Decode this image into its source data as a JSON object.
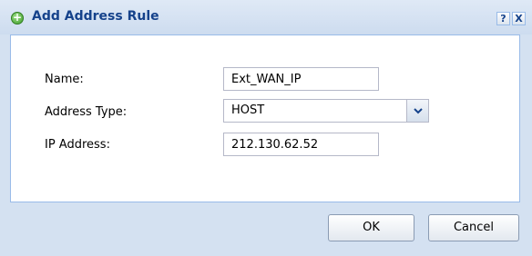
{
  "dialog": {
    "title": "Add Address Rule",
    "help_label": "?",
    "close_label": "X"
  },
  "form": {
    "name_label": "Name:",
    "name_value": "Ext_WAN_IP",
    "address_type_label": "Address Type:",
    "address_type_value": "HOST",
    "ip_label": "IP Address:",
    "ip_value": "212.130.62.52"
  },
  "buttons": {
    "ok": "OK",
    "cancel": "Cancel"
  }
}
